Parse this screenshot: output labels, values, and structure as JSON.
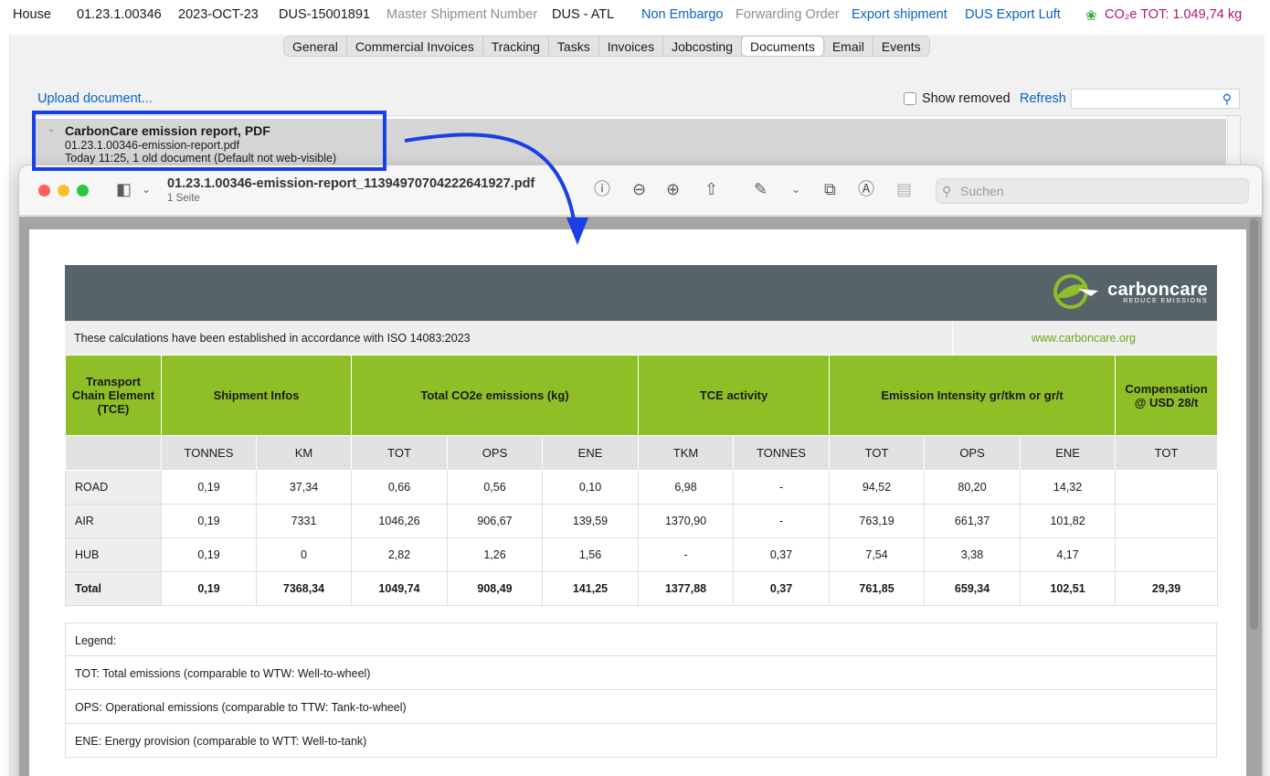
{
  "header": {
    "house": "House",
    "ref": "01.23.1.00346",
    "date": "2023-OCT-23",
    "shipment_id": "DUS-15001891",
    "master_label": "Master Shipment Number",
    "route": "DUS - ATL",
    "embargo": "Non Embargo",
    "forwarding": "Forwarding Order",
    "export": "Export shipment",
    "export_luft": "DUS Export Luft",
    "co2": "CO₂e TOT: 1.049,74 kg"
  },
  "tabs": [
    "General",
    "Commercial Invoices",
    "Tracking",
    "Tasks",
    "Invoices",
    "Jobcosting",
    "Documents",
    "Email",
    "Events"
  ],
  "active_tab": "Documents",
  "documents": {
    "upload_label": "Upload document...",
    "show_removed_label": "Show removed",
    "refresh_label": "Refresh",
    "search_value": "",
    "item": {
      "title": "CarbonCare emission report, PDF",
      "filename": "01.23.1.00346-emission-report.pdf",
      "meta": "Today 11:25, 1 old document  (Default not web-visible)"
    }
  },
  "preview": {
    "title": "01.23.1.00346-emission-report_11394970704222641927.pdf",
    "pages": "1 Seite",
    "search_placeholder": "Suchen"
  },
  "report": {
    "brand": "carboncare",
    "tagline": "REDUCE EMISSIONS",
    "iso_text": "These calculations have been established in accordance with ISO 14083:2023",
    "website": "www.carboncare.org",
    "group_headers": {
      "tce": "Transport Chain Element (TCE)",
      "shipment": "Shipment Infos",
      "total_co2": "Total CO2e emissions (kg)",
      "tce_activity": "TCE activity",
      "intensity": "Emission Intensity gr/tkm or gr/t",
      "compensation": "Compensation @ USD 28/t"
    },
    "sub_headers": [
      "",
      "TONNES",
      "KM",
      "TOT",
      "OPS",
      "ENE",
      "TKM",
      "TONNES",
      "TOT",
      "OPS",
      "ENE",
      "TOT"
    ],
    "rows": [
      [
        "ROAD",
        "0,19",
        "37,34",
        "0,66",
        "0,56",
        "0,10",
        "6,98",
        "-",
        "94,52",
        "80,20",
        "14,32",
        ""
      ],
      [
        "AIR",
        "0,19",
        "7331",
        "1046,26",
        "906,67",
        "139,59",
        "1370,90",
        "-",
        "763,19",
        "661,37",
        "101,82",
        ""
      ],
      [
        "HUB",
        "0,19",
        "0",
        "2,82",
        "1,26",
        "1,56",
        "-",
        "0,37",
        "7,54",
        "3,38",
        "4,17",
        ""
      ],
      [
        "Total",
        "0,19",
        "7368,34",
        "1049,74",
        "908,49",
        "141,25",
        "1377,88",
        "0,37",
        "761,85",
        "659,34",
        "102,51",
        "29,39"
      ]
    ],
    "legend": [
      "Legend:",
      "TOT: Total emissions (comparable to WTW: Well-to-wheel)",
      "OPS: Operational emissions (comparable to TTW: Tank-to-wheel)",
      "ENE: Energy provision (comparable to WTT: Well-to-tank)"
    ]
  },
  "colors": {
    "link": "#0a62c8",
    "co2": "#b0167a",
    "highlight": "#1a3fe6",
    "report_header": "#56646a",
    "report_green": "#8fbf27"
  }
}
